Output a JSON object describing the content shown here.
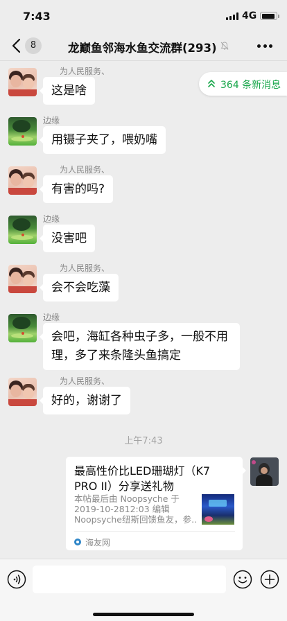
{
  "status_bar": {
    "time": "7:43",
    "network": "4G"
  },
  "nav": {
    "unread_count": "8",
    "title": "龙巅鱼邻海水鱼交流群(293)"
  },
  "new_messages_pill": {
    "label": "364 条新消息",
    "accent": "#19a74b"
  },
  "messages": [
    {
      "sender": "为人民服务、",
      "avatar": "people-avatar",
      "text": "这是啥"
    },
    {
      "sender": "边缘",
      "avatar": "nature-avatar",
      "text": "用镊子夹了，喂奶嘴"
    },
    {
      "sender": "为人民服务、",
      "avatar": "people-avatar",
      "text": "有害的吗?"
    },
    {
      "sender": "边缘",
      "avatar": "nature-avatar",
      "text": "没害吧"
    },
    {
      "sender": "为人民服务、",
      "avatar": "people-avatar",
      "text": "会不会吃藻"
    },
    {
      "sender": "边缘",
      "avatar": "nature-avatar",
      "text": "会吧，海缸各种虫子多，一般不用理，多了来条隆头鱼搞定"
    },
    {
      "sender": "为人民服务、",
      "avatar": "people-avatar",
      "text": "好的，谢谢了"
    }
  ],
  "timestamp": "上午7:43",
  "link_card": {
    "title": "最高性价比LED珊瑚灯（K7 PRO II）分享送礼物",
    "desc_line1": "本帖最后由 Noopsyche 于",
    "desc_line2": "2019-10-2812:03 编辑",
    "desc_line3": "Noopsyche纽斯回馈鱼友，参…",
    "source": "海友网"
  },
  "colors": {
    "background": "#ededed",
    "bubble": "#ffffff",
    "accent": "#19a74b"
  }
}
